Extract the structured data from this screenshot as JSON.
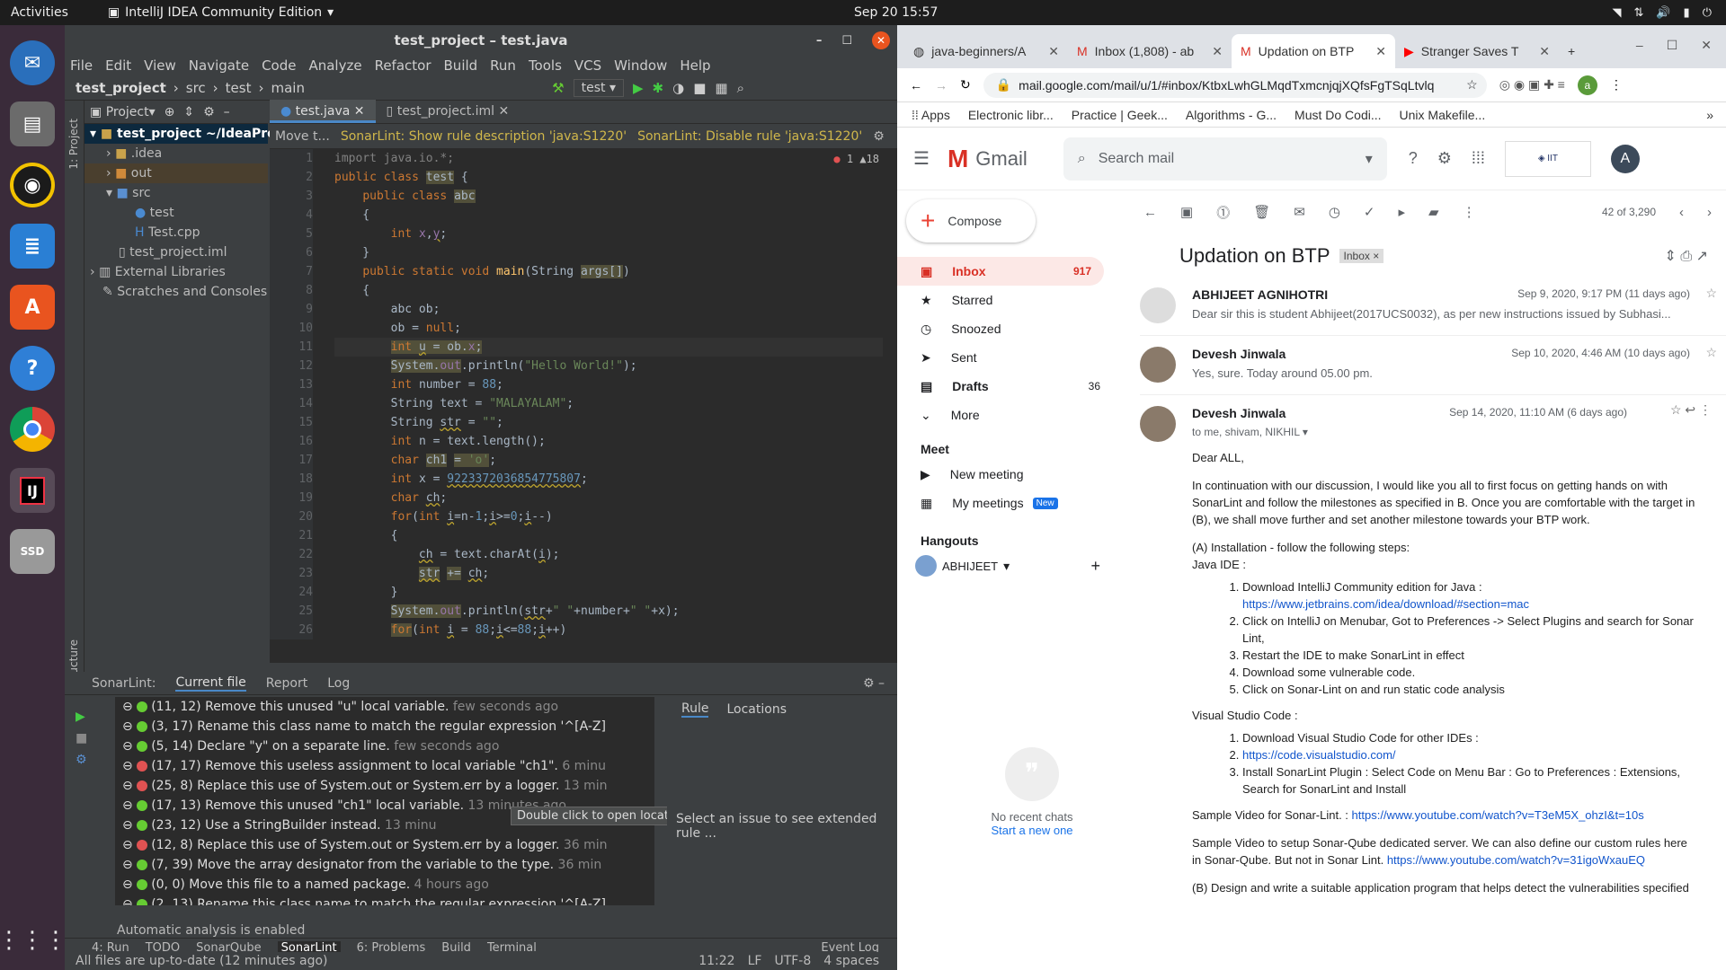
{
  "os": {
    "activities": "Activities",
    "app": "IntelliJ IDEA Community Edition",
    "clock": "Sep 20  15:57"
  },
  "ij": {
    "title": "test_project – test.java",
    "menu": [
      "File",
      "Edit",
      "View",
      "Navigate",
      "Code",
      "Analyze",
      "Refactor",
      "Build",
      "Run",
      "Tools",
      "VCS",
      "Window",
      "Help"
    ],
    "breadcrumb": [
      "test_project",
      "src",
      "test",
      "main"
    ],
    "run_config": "test",
    "project_label": "Project",
    "tree": [
      {
        "t": "test_project ~/IdeaPro",
        "d": 0,
        "sel": true
      },
      {
        "t": ".idea",
        "d": 1
      },
      {
        "t": "out",
        "d": 1
      },
      {
        "t": "src",
        "d": 1
      },
      {
        "t": "test",
        "d": 2
      },
      {
        "t": "Test.cpp",
        "d": 2
      },
      {
        "t": "test_project.iml",
        "d": 1
      },
      {
        "t": "External Libraries",
        "d": 0
      },
      {
        "t": "Scratches and Consoles",
        "d": 0
      }
    ],
    "tabs": [
      "test.java",
      "test_project.iml"
    ],
    "banner": {
      "move": "Move t...",
      "show": "SonarLint: Show rule description 'java:S1220'",
      "disable": "SonarLint: Disable rule 'java:S1220'"
    },
    "inspect": "1  ▲18",
    "code": [
      "import java.io.*;",
      "public class test {",
      "    public class abc",
      "    {",
      "        int x,y;",
      "    }",
      "    public static void main(String args[])",
      "    {",
      "        abc ob;",
      "        ob = null;",
      "        int u = ob.x;",
      "        System.out.println(\"Hello World!\");",
      "        int number = 88;",
      "        String text = \"MALAYALAM\";",
      "        String str = \"\";",
      "        int n = text.length();",
      "        char ch1 = 'o';",
      "        int x = 9223372036854775807;",
      "        char ch;",
      "        for(int i=n-1;i>=0;i--)",
      "        {",
      "            ch = text.charAt(i);",
      "            str += ch;",
      "        }",
      "        System.out.println(str+\" \"+number+\" \"+x);",
      "        for(int i = 88;i<=88;i++)"
    ],
    "bottom_tabs": [
      "SonarLint:",
      "Current file",
      "Report",
      "Log"
    ],
    "issues": [
      {
        "p": "(11, 12)",
        "t": "Remove this unused \"u\" local variable.",
        "a": "few seconds ago",
        "r": false
      },
      {
        "p": "(3, 17)",
        "t": "Rename this class name to match the regular expression '^[A-Z]",
        "a": "",
        "r": false
      },
      {
        "p": "(5, 14)",
        "t": "Declare \"y\" on a separate line.",
        "a": "few seconds ago",
        "r": false
      },
      {
        "p": "(17, 17)",
        "t": "Remove this useless assignment to local variable \"ch1\".",
        "a": "6 minu",
        "r": true
      },
      {
        "p": "(25, 8)",
        "t": "Replace this use of System.out or System.err by a logger.",
        "a": "13 min",
        "r": true
      },
      {
        "p": "(17, 13)",
        "t": "Remove this unused \"ch1\" local variable.",
        "a": "13 minutes ago",
        "r": false
      },
      {
        "p": "(23, 12)",
        "t": "Use a StringBuilder instead.",
        "a": "13 minu",
        "r": false
      },
      {
        "p": "(12, 8)",
        "t": "Replace this use of System.out or System.err by a logger.",
        "a": "36 min",
        "r": true
      },
      {
        "p": "(7, 39)",
        "t": "Move the array designator from the variable to the type.",
        "a": "36 min",
        "r": false
      },
      {
        "p": "(0, 0)",
        "t": "Move this file to a named package.",
        "a": "4 hours ago",
        "r": false
      },
      {
        "p": "(2, 13)",
        "t": "Rename this class name to match the regular expression '^[A-Z]",
        "a": "",
        "r": false
      }
    ],
    "tooltip": "Double click to open location",
    "rule_tabs": [
      "Rule",
      "Locations"
    ],
    "rule_msg": "Select an issue to see extended rule ...",
    "auto": "Automatic analysis is enabled",
    "toolbar": [
      "4: Run",
      "TODO",
      "SonarQube",
      "SonarLint",
      "6: Problems",
      "Build",
      "Terminal",
      "Event Log"
    ],
    "status": {
      "msg": "All files are up-to-date (12 minutes ago)",
      "pos": "11:22",
      "le": "LF",
      "enc": "UTF-8",
      "indent": "4 spaces"
    }
  },
  "chrome": {
    "tabs": [
      "java-beginners/A",
      "Inbox (1,808) - ab",
      "Updation on BTP",
      "Stranger Saves T"
    ],
    "url": "mail.google.com/mail/u/1/#inbox/KtbxLwhGLMqdTxmcnjqjXQfsFgTSqLtvlq",
    "bookmarks": [
      "Apps",
      "Electronic libr...",
      "Practice | Geek...",
      "Algorithms - G...",
      "Must Do Codi...",
      "Unix Makefile..."
    ]
  },
  "gmail": {
    "brand": "Gmail",
    "search": "Search mail",
    "compose": "Compose",
    "nav": [
      {
        "l": "Inbox",
        "c": "917"
      },
      {
        "l": "Starred",
        "c": ""
      },
      {
        "l": "Snoozed",
        "c": ""
      },
      {
        "l": "Sent",
        "c": ""
      },
      {
        "l": "Drafts",
        "c": "36"
      },
      {
        "l": "More",
        "c": ""
      }
    ],
    "meet": "Meet",
    "new_meeting": "New meeting",
    "my_meetings": "My meetings",
    "new_badge": "New",
    "hangouts": "Hangouts",
    "hangout_user": "ABHIJEET",
    "no_chats": "No recent chats",
    "start_new": "Start a new one",
    "counter": "42 of 3,290",
    "subject": "Updation on BTP",
    "label": "Inbox",
    "messages": [
      {
        "from": "ABHIJEET AGNIHOTRI",
        "date": "Sep 9, 2020, 9:17 PM (11 days ago)",
        "snip": "Dear sir this is student Abhijeet(2017UCS0032), as per new instructions issued by Subhasi..."
      },
      {
        "from": "Devesh Jinwala",
        "date": "Sep 10, 2020, 4:46 AM (10 days ago)",
        "snip": "Yes, sure. Today around 05.00 pm."
      },
      {
        "from": "Devesh Jinwala",
        "date": "Sep 14, 2020, 11:10 AM (6 days ago)",
        "snip": "to me, shivam, NIKHIL"
      }
    ],
    "body": {
      "greet": "Dear ALL,",
      "p1": "In continuation with our discussion, I would like you all to first focus on getting hands on with SonarLint and follow the milestones as specified in B. Once you are comfortable with the target in (B), we shall move further and set another milestone towards your BTP work.",
      "a_head": "(A) Installation - follow the following steps:",
      "java_ide": "Java IDE :",
      "java_steps": [
        "Download IntelliJ Community edition for Java : ",
        "Click on  IntelliJ on Menubar, Got to Preferences -> Select Plugins and search for Sonar Lint,",
        "Restart the IDE to make SonarLint in effect",
        "Download some vulnerable code.",
        "Click on Sonar-Lint on and run static code analysis"
      ],
      "jb_link": "https://www.jetbrains.com/idea/download/#section=mac",
      "vsc": "Visual Studio Code :",
      "vsc_steps": [
        "Download Visual Studio Code for other IDEs :",
        "",
        "Install SonarLint Plugin  : Select Code on Menu Bar : Go to Preferences : Extensions, Search for SonarLint and Install"
      ],
      "vsc_link": "https://code.visualstudio.com/",
      "sample1": "Sample Video for Sonar-Lint. : ",
      "yt1": "https://www.youtube.com/watch?v=T3eM5X_ohzI&t=10s",
      "sample2": "Sample Video to setup Sonar-Qube dedicated server. We can also define our custom rules here in Sonar-Qube. But not in Sonar Lint.  ",
      "yt2": "https://www.youtube.com/watch?v=31igoWxauEQ",
      "p_b": "(B) Design and write a suitable application program that helps detect the vulnerabilities specified"
    }
  }
}
